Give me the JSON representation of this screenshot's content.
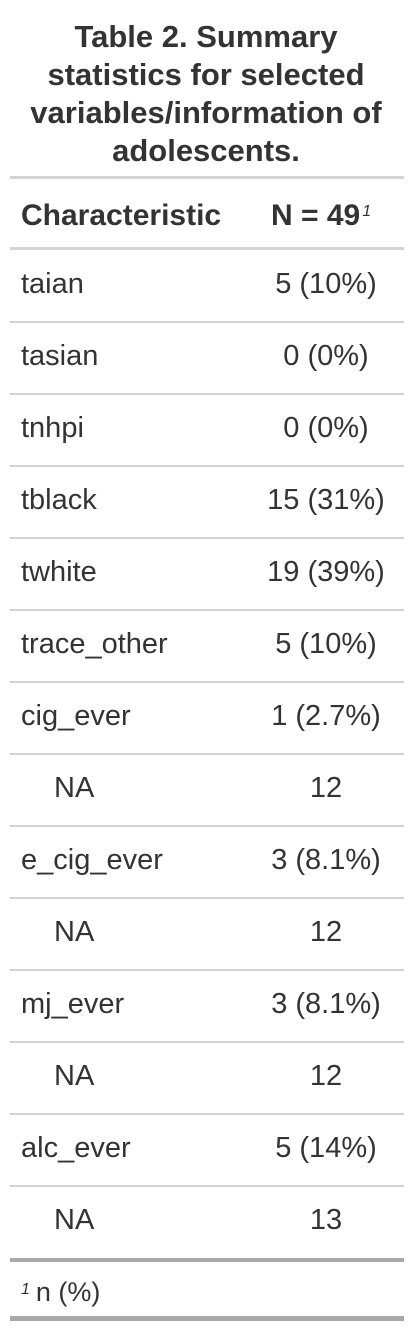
{
  "table": {
    "title": "Table 2. Summary statistics for selected variables/information of adolescents.",
    "header": {
      "characteristic": "Characteristic",
      "n_label": "N = 49",
      "n_footnote_marker": "1"
    },
    "rows": [
      {
        "label": "taian",
        "value": "5 (10%)",
        "indent": false
      },
      {
        "label": "tasian",
        "value": "0 (0%)",
        "indent": false
      },
      {
        "label": "tnhpi",
        "value": "0 (0%)",
        "indent": false
      },
      {
        "label": "tblack",
        "value": "15 (31%)",
        "indent": false
      },
      {
        "label": "twhite",
        "value": "19 (39%)",
        "indent": false
      },
      {
        "label": "trace_other",
        "value": "5 (10%)",
        "indent": false
      },
      {
        "label": "cig_ever",
        "value": "1 (2.7%)",
        "indent": false
      },
      {
        "label": "NA",
        "value": "12",
        "indent": true
      },
      {
        "label": "e_cig_ever",
        "value": "3 (8.1%)",
        "indent": false
      },
      {
        "label": "NA",
        "value": "12",
        "indent": true
      },
      {
        "label": "mj_ever",
        "value": "3 (8.1%)",
        "indent": false
      },
      {
        "label": "NA",
        "value": "12",
        "indent": true
      },
      {
        "label": "alc_ever",
        "value": "5 (14%)",
        "indent": false
      },
      {
        "label": "NA",
        "value": "13",
        "indent": true
      }
    ],
    "footnote": {
      "marker": "1",
      "text": "n (%)"
    }
  }
}
